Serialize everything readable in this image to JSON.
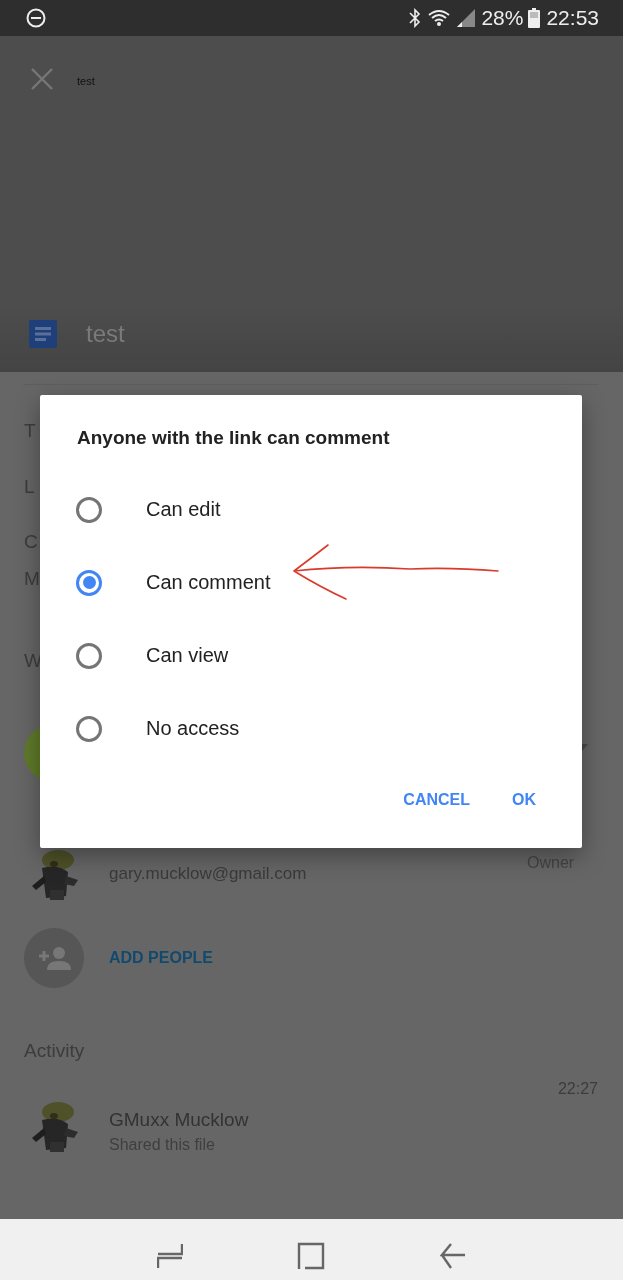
{
  "status_bar": {
    "battery": "28%",
    "time": "22:53"
  },
  "header": {
    "tab_title": "test",
    "file_name": "test"
  },
  "details": [
    "T",
    "L",
    "C",
    "M"
  ],
  "access": {
    "heading": "W",
    "owner_email": "gary.mucklow@gmail.com",
    "owner_role": "Owner",
    "add_people": "ADD PEOPLE"
  },
  "activity": {
    "heading": "Activity",
    "items": [
      {
        "time": "22:27",
        "name": "GMuxx Mucklow",
        "action": "Shared this file"
      }
    ]
  },
  "dialog": {
    "title": "Anyone with the link can comment",
    "options": [
      {
        "label": "Can edit",
        "selected": false
      },
      {
        "label": "Can comment",
        "selected": true
      },
      {
        "label": "Can view",
        "selected": false
      },
      {
        "label": "No access",
        "selected": false
      }
    ],
    "buttons": [
      "CANCEL",
      "OK"
    ]
  }
}
